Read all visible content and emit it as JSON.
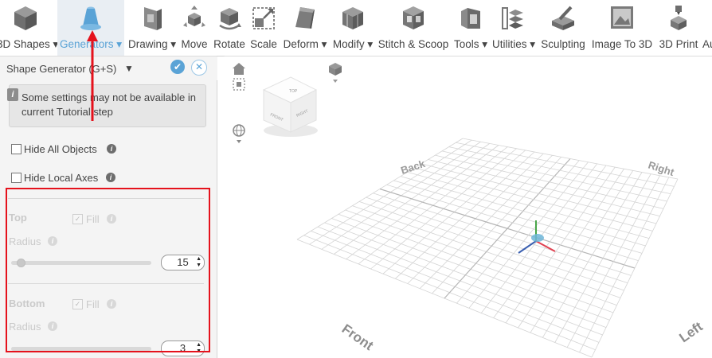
{
  "toolbar": {
    "items": [
      {
        "label": "3D Shapes ▾",
        "icon": "cube-icon"
      },
      {
        "label": "Generators ▾",
        "icon": "generator-cone-icon"
      },
      {
        "label": "Drawing ▾",
        "icon": "drawing-icon"
      },
      {
        "label": "Move",
        "icon": "move-icon"
      },
      {
        "label": "Rotate",
        "icon": "rotate-icon"
      },
      {
        "label": "Scale",
        "icon": "scale-icon"
      },
      {
        "label": "Deform ▾",
        "icon": "deform-icon"
      },
      {
        "label": "Modify ▾",
        "icon": "modify-icon"
      },
      {
        "label": "Stitch & Scoop",
        "icon": "stitch-scoop-icon"
      },
      {
        "label": "Tools ▾",
        "icon": "tools-icon"
      },
      {
        "label": "Utilities ▾",
        "icon": "utilities-icon"
      },
      {
        "label": "Sculpting",
        "icon": "sculpting-icon"
      },
      {
        "label": "Image To 3D",
        "icon": "image-to-3d-icon"
      },
      {
        "label": "3D Print",
        "icon": "3d-print-icon"
      },
      {
        "label": "Au",
        "icon": "overflow-icon"
      }
    ]
  },
  "panel": {
    "title": "Shape Generator (G+S)",
    "caret": "▼",
    "ok": "✔",
    "close": "✕",
    "notice": "Some settings may not be available in current Tutorial step",
    "hide_all_objects": "Hide All Objects",
    "hide_local_axes": "Hide Local Axes",
    "top": {
      "heading": "Top",
      "fill_label": "Fill",
      "radius_label": "Radius",
      "radius_value": "15"
    },
    "bottom": {
      "heading": "Bottom",
      "fill_label": "Fill",
      "radius_label": "Radius",
      "radius_value": "3"
    }
  },
  "viewport": {
    "cube_faces": {
      "top": "TOP",
      "front": "FRONT",
      "right": "RIGHT"
    },
    "edge_labels": {
      "back": "Back",
      "right": "Right",
      "front": "Front",
      "left": "Left"
    }
  },
  "colors": {
    "accent": "#5aa3d6",
    "annotation": "#e5121c",
    "axis_x": "#e04050",
    "axis_y": "#4aa64a",
    "axis_z": "#3a5fb0"
  }
}
